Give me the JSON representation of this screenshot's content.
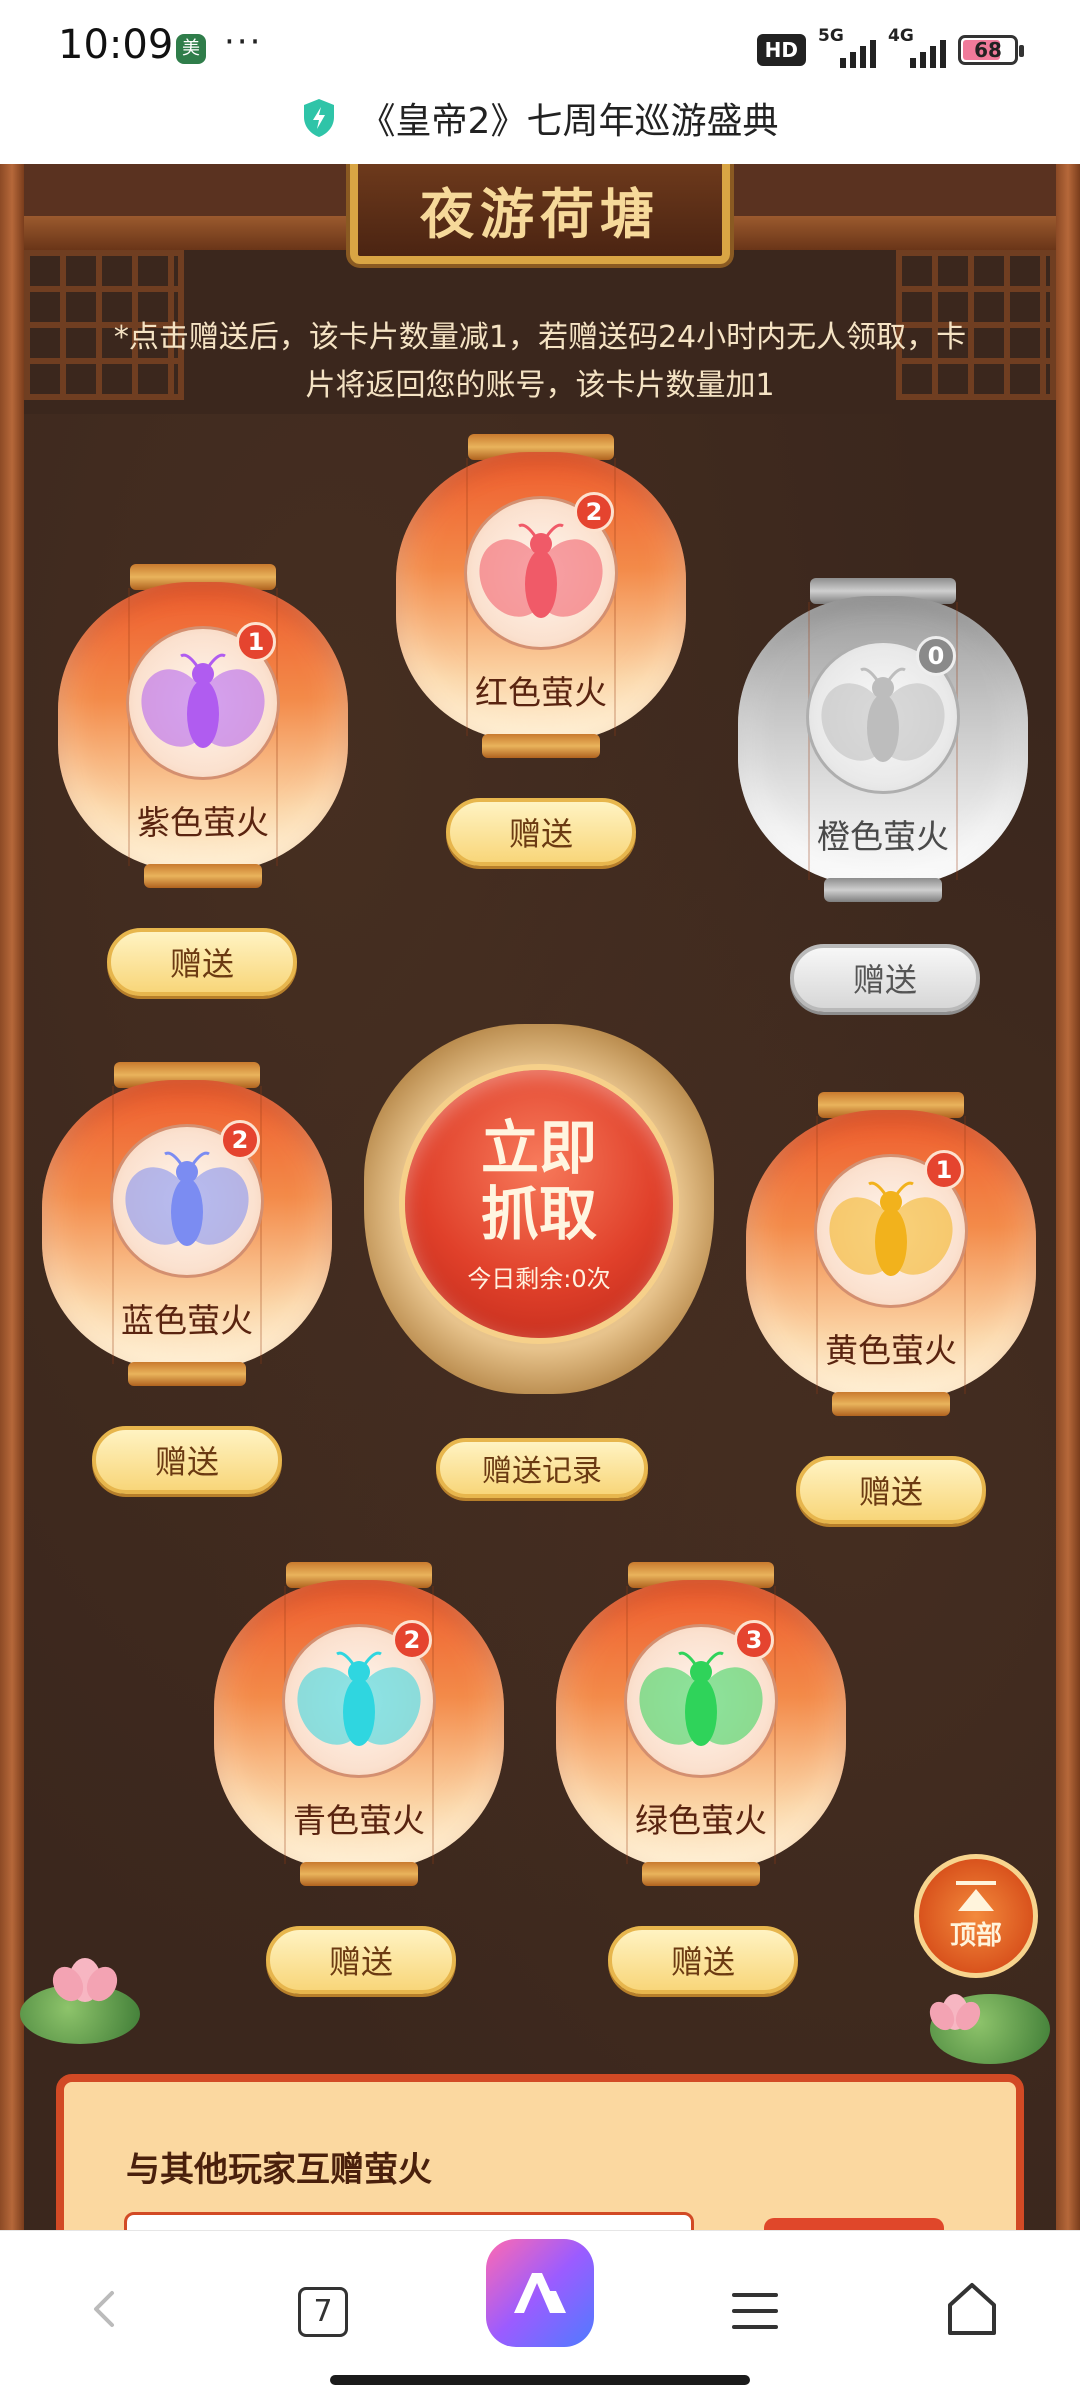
{
  "status_bar": {
    "time": "10:09",
    "app_icon_char": "美",
    "more": "···",
    "hd": "HD",
    "net1": "5G",
    "net2": "4G",
    "battery": "68",
    "battery_level": 0.68
  },
  "header": {
    "title": "《皇帝2》七周年巡游盛典",
    "shield_color": "#2fc4a8"
  },
  "game": {
    "banner": "夜游荷塘",
    "notice": "*点击赠送后，该卡片数量减1，若赠送码24小时内无人领取，卡片将返回您的账号，该卡片数量加1",
    "lanterns": [
      {
        "id": "purple",
        "label": "紫色萤火",
        "count": "1",
        "bug_color": "#b05cf0",
        "give": "赠送"
      },
      {
        "id": "red",
        "label": "红色萤火",
        "count": "2",
        "bug_color": "#f05a68",
        "give": "赠送"
      },
      {
        "id": "orange",
        "label": "橙色萤火",
        "count": "0",
        "bug_color": "#bdbdbd",
        "give": "赠送"
      },
      {
        "id": "blue",
        "label": "蓝色萤火",
        "count": "2",
        "bug_color": "#7b8cf2",
        "give": "赠送"
      },
      {
        "id": "yellow",
        "label": "黄色萤火",
        "count": "1",
        "bug_color": "#f2b21c",
        "give": "赠送"
      },
      {
        "id": "cyan",
        "label": "青色萤火",
        "count": "2",
        "bug_color": "#2fd6e0",
        "give": "赠送"
      },
      {
        "id": "green",
        "label": "绿色萤火",
        "count": "3",
        "bug_color": "#2fd35a",
        "give": "赠送"
      }
    ],
    "catch_button": {
      "label": "立即抓取",
      "remaining": "今日剩余:0次"
    },
    "record_button": "赠送记录",
    "top_button": "顶部",
    "panel_title": "与其他玩家互赠萤火"
  },
  "browser": {
    "tabs_count": "7"
  }
}
